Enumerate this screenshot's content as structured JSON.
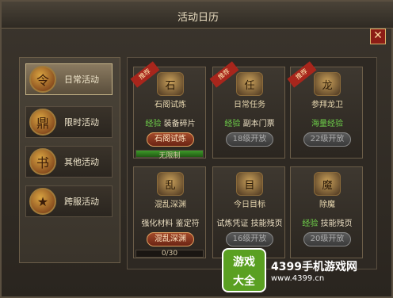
{
  "window": {
    "title": "活动日历",
    "close_icon": "✕"
  },
  "tabs": [
    {
      "label": "日常活动",
      "icon": "scroll-icon",
      "glyph": "令",
      "active": true
    },
    {
      "label": "限时活动",
      "icon": "cauldron-icon",
      "glyph": "鼎",
      "active": false
    },
    {
      "label": "其他活动",
      "icon": "book-icon",
      "glyph": "书",
      "active": false
    },
    {
      "label": "跨服活动",
      "icon": "emblem-icon",
      "glyph": "★",
      "active": false
    }
  ],
  "cards": [
    {
      "ribbon": "推荐",
      "glyph": "石",
      "name": "石阁试炼",
      "reward_green": "经验",
      "reward_rest": " 装备碎片",
      "button": "石阁试炼",
      "enabled": true,
      "progress_text": "无限制",
      "progress": 1.0
    },
    {
      "ribbon": "推荐",
      "glyph": "任",
      "name": "日常任务",
      "reward_green": "经验",
      "reward_rest": " 副本门票",
      "button": "18级开放",
      "enabled": false,
      "progress_text": "",
      "progress": null
    },
    {
      "ribbon": "推荐",
      "glyph": "龙",
      "name": "参拜龙卫",
      "reward_green": "海量经验",
      "reward_rest": "",
      "button": "22级开放",
      "enabled": false,
      "progress_text": "",
      "progress": null
    },
    {
      "ribbon": "",
      "glyph": "乱",
      "name": "混乱深渊",
      "reward_green": "",
      "reward_rest": "强化材料 鉴定符",
      "button": "混乱深渊",
      "enabled": true,
      "progress_text": "0/30",
      "progress": 0.0
    },
    {
      "ribbon": "",
      "glyph": "目",
      "name": "今日目标",
      "reward_green": "",
      "reward_rest": "试炼凭证 技能残页",
      "button": "16级开放",
      "enabled": false,
      "progress_text": "",
      "progress": null
    },
    {
      "ribbon": "",
      "glyph": "魔",
      "name": "除魔",
      "reward_green": "经验",
      "reward_rest": " 技能残页",
      "button": "20级开放",
      "enabled": false,
      "progress_text": "",
      "progress": null
    }
  ],
  "watermark": {
    "badge_line1": "游戏",
    "badge_line2": "大全",
    "site": "4399手机游戏网",
    "url": "www.4399.cn"
  }
}
